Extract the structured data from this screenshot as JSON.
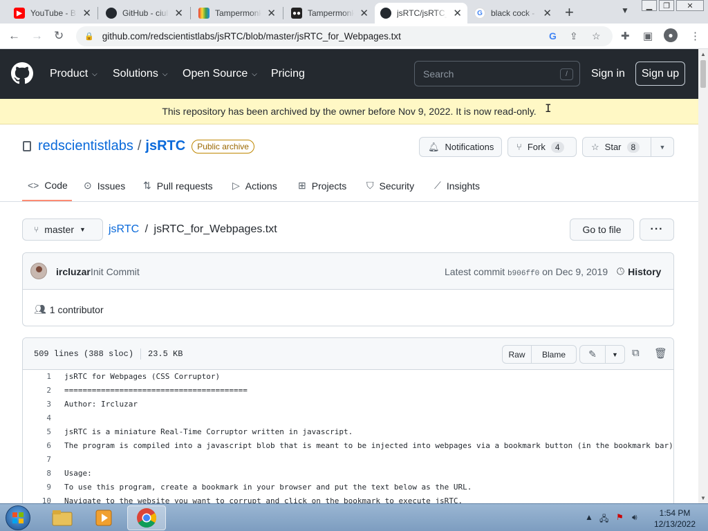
{
  "browser": {
    "tabs": [
      {
        "title": "YouTube - Br",
        "icon": "youtube-icon",
        "active": false
      },
      {
        "title": "GitHub - ciul",
        "icon": "github-icon",
        "active": false
      },
      {
        "title": "Tampermonk",
        "icon": "rainbow-icon",
        "active": false
      },
      {
        "title": "Tampermonk",
        "icon": "tampermonkey-icon",
        "active": false
      },
      {
        "title": "jsRTC/jsRTC_",
        "icon": "github-icon",
        "active": true
      },
      {
        "title": "black cock -",
        "icon": "google-icon",
        "active": false
      }
    ],
    "url": "github.com/redscientistlabs/jsRTC/blob/master/jsRTC_for_Webpages.txt"
  },
  "gh": {
    "nav": [
      "Product",
      "Solutions",
      "Open Source",
      "Pricing"
    ],
    "search_placeholder": "Search",
    "search_key": "/",
    "sign_in": "Sign in",
    "sign_up": "Sign up"
  },
  "banner": "This repository has been archived by the owner before Nov 9, 2022. It is now read-only.",
  "repo": {
    "owner": "redscientistlabs",
    "separator": "/",
    "name": "jsRTC",
    "badge": "Public archive",
    "notifications": "Notifications",
    "fork_label": "Fork",
    "fork_count": "4",
    "star_label": "Star",
    "star_count": "8"
  },
  "repo_tabs": [
    "Code",
    "Issues",
    "Pull requests",
    "Actions",
    "Projects",
    "Security",
    "Insights"
  ],
  "filenav": {
    "branch": "master",
    "path_repo": "jsRTC",
    "path_sep": "/",
    "path_file": "jsRTC_for_Webpages.txt",
    "goto_file": "Go to file",
    "more": "···"
  },
  "commit": {
    "author": "ircluzar",
    "message": "Init Commit",
    "latest_prefix": "Latest commit",
    "sha": "b906ff0",
    "date": "on Dec 9, 2019",
    "history": "History",
    "contributors": "1 contributor"
  },
  "file": {
    "lines_info": "509 lines (388 sloc)",
    "size": "23.5 KB",
    "raw": "Raw",
    "blame": "Blame",
    "code": [
      {
        "n": "1",
        "t": "jsRTC for Webpages (CSS Corruptor)"
      },
      {
        "n": "2",
        "t": "========================================"
      },
      {
        "n": "3",
        "t": "Author: Ircluzar"
      },
      {
        "n": "4",
        "t": ""
      },
      {
        "n": "5",
        "t": "jsRTC is a miniature Real-Time Corruptor written in javascript."
      },
      {
        "n": "6",
        "t": "The program is compiled into a javascript blob that is meant to be injected into webpages via a bookmark button (in the bookmark bar)."
      },
      {
        "n": "7",
        "t": ""
      },
      {
        "n": "8",
        "t": "Usage:"
      },
      {
        "n": "9",
        "t": "To use this program, create a bookmark in your browser and put the text below as the URL."
      },
      {
        "n": "10",
        "t": "Navigate to the website you want to corrupt and click on the bookmark to execute jsRTC."
      }
    ]
  },
  "taskbar": {
    "time": "1:54 PM",
    "date": "12/13/2022"
  },
  "colors": {
    "gh_header": "#24292f",
    "banner": "#fff8c5",
    "link": "#0969da",
    "tab_underline": "#fd8c73"
  }
}
